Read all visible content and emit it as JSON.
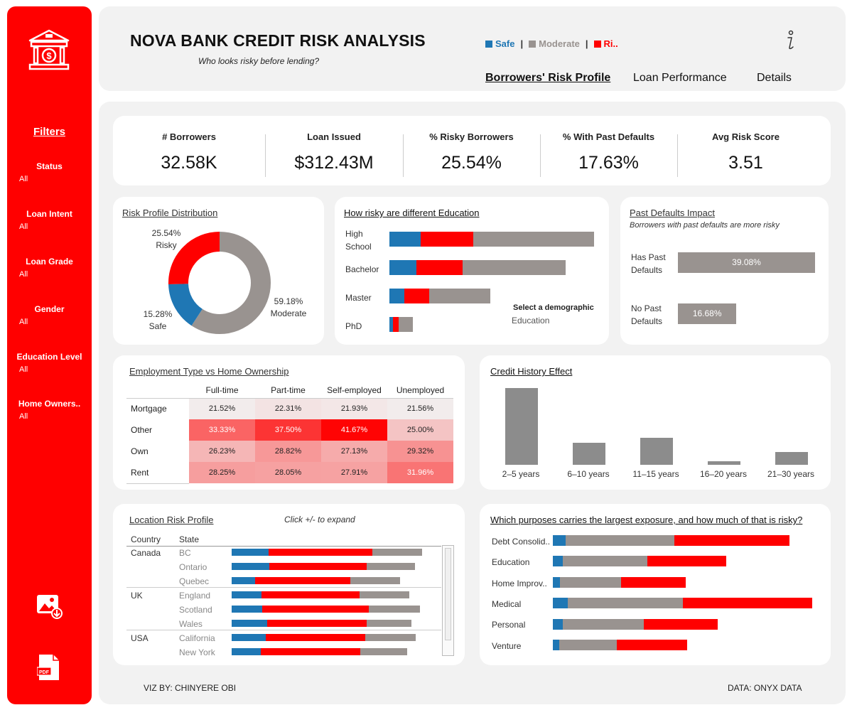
{
  "colors": {
    "safe": "#1f77b4",
    "moderate": "#999390",
    "risky": "#ff0000",
    "sidebar": "#ff0000"
  },
  "sidebar": {
    "logo_icon": "bank-icon",
    "filters_title": "Filters",
    "filters": [
      {
        "label": "Status",
        "value": "All"
      },
      {
        "label": "Loan Intent",
        "value": "All"
      },
      {
        "label": "Loan Grade",
        "value": "All"
      },
      {
        "label": "Gender",
        "value": "All"
      },
      {
        "label": "Education Level",
        "value": "All"
      },
      {
        "label": "Home Owners..",
        "value": "All"
      }
    ],
    "image_export_icon": "image-download-icon",
    "pdf_export_icon": "pdf-icon",
    "pdf_label": "PDF"
  },
  "header": {
    "title": "NOVA BANK CREDIT RISK ANALYSIS",
    "subtitle": "Who looks risky before lending?",
    "legend": {
      "safe": "Safe",
      "moderate": "Moderate",
      "risky": "Ri.."
    },
    "info_icon": "info-icon",
    "nav": [
      "Borrowers' Risk Profile",
      "Loan Performance",
      "Details"
    ]
  },
  "kpis": [
    {
      "label": "# Borrowers",
      "value": "32.58K"
    },
    {
      "label": "Loan Issued",
      "value": "$312.43M"
    },
    {
      "label": "% Risky Borrowers",
      "value": "25.54%"
    },
    {
      "label": "% With Past Defaults",
      "value": "17.63%"
    },
    {
      "label": "Avg Risk Score",
      "value": "3.51"
    }
  ],
  "risk_distribution": {
    "title": "Risk Profile Distribution",
    "risky_pct": "25.54%",
    "risky_label": "Risky",
    "safe_pct": "15.28%",
    "safe_label": "Safe",
    "moderate_pct": "59.18%",
    "moderate_label": "Moderate"
  },
  "education": {
    "title": "How risky are different Education",
    "levels": [
      "High School",
      "Bachelor",
      "Master",
      "PhD"
    ],
    "hint_title": "Select a demographic",
    "hint_value": "Education"
  },
  "past_defaults": {
    "title": "Past Defaults Impact",
    "subtitle": "Borrowers with past defaults are more risky",
    "rows": [
      {
        "label": "Has Past Defaults",
        "value": "39.08%"
      },
      {
        "label": "No Past Defaults",
        "value": "16.68%"
      }
    ]
  },
  "employment": {
    "title": "Employment Type vs Home Ownership",
    "columns": [
      "Full-time",
      "Part-time",
      "Self-employed",
      "Unemployed"
    ],
    "rows": [
      {
        "label": "Mortgage",
        "cells": [
          "21.52%",
          "22.31%",
          "21.93%",
          "21.56%"
        ]
      },
      {
        "label": "Other",
        "cells": [
          "33.33%",
          "37.50%",
          "41.67%",
          "25.00%"
        ]
      },
      {
        "label": "Own",
        "cells": [
          "26.23%",
          "28.82%",
          "27.13%",
          "29.32%"
        ]
      },
      {
        "label": "Rent",
        "cells": [
          "28.25%",
          "28.05%",
          "27.91%",
          "31.96%"
        ]
      }
    ]
  },
  "credit_history": {
    "title": "Credit History Effect",
    "categories": [
      "2–5 years",
      "6–10 years",
      "11–15 years",
      "16–20 years",
      "21–30 years"
    ]
  },
  "location": {
    "title": "Location Risk Profile",
    "hint": "Click +/- to expand",
    "col_country": "Country",
    "col_state": "State",
    "countries": [
      "Canada",
      "UK",
      "USA"
    ],
    "states": [
      "BC",
      "Ontario",
      "Quebec",
      "England",
      "Scotland",
      "Wales",
      "California",
      "New York"
    ]
  },
  "purposes": {
    "title": "Which purposes carries the largest exposure, and how much of that is risky?",
    "items": [
      "Debt Consolid..",
      "Education",
      "Home Improv..",
      "Medical",
      "Personal",
      "Venture"
    ]
  },
  "footer": {
    "left": "VIZ BY: CHINYERE OBI",
    "right": "DATA: ONYX DATA"
  },
  "chart_data": [
    {
      "type": "pie",
      "title": "Risk Profile Distribution",
      "categories": [
        "Risky",
        "Safe",
        "Moderate"
      ],
      "values": [
        25.54,
        15.28,
        59.18
      ]
    },
    {
      "type": "bar",
      "title": "How risky are different Education",
      "categories": [
        "High School",
        "Bachelor",
        "Master",
        "PhD"
      ],
      "series": [
        {
          "name": "Safe",
          "values": [
            44,
            38,
            21,
            5
          ]
        },
        {
          "name": "Risky",
          "values": [
            74,
            65,
            35,
            8
          ]
        },
        {
          "name": "Moderate",
          "values": [
            170,
            145,
            86,
            20
          ]
        }
      ]
    },
    {
      "type": "bar",
      "title": "Past Defaults Impact",
      "categories": [
        "Has Past Defaults",
        "No Past Defaults"
      ],
      "values": [
        39.08,
        16.68
      ],
      "xlim": [
        0,
        42
      ]
    },
    {
      "type": "heatmap",
      "title": "Employment Type vs Home Ownership",
      "x": [
        "Full-time",
        "Part-time",
        "Self-employed",
        "Unemployed"
      ],
      "y": [
        "Mortgage",
        "Other",
        "Own",
        "Rent"
      ],
      "values": [
        [
          21.52,
          22.31,
          21.93,
          21.56
        ],
        [
          33.33,
          37.5,
          41.67,
          25.0
        ],
        [
          26.23,
          28.82,
          27.13,
          29.32
        ],
        [
          28.25,
          28.05,
          27.91,
          31.96
        ]
      ],
      "range": [
        21,
        42
      ]
    },
    {
      "type": "bar",
      "title": "Credit History Effect",
      "categories": [
        "2–5 years",
        "6–10 years",
        "11–15 years",
        "16–20 years",
        "21–30 years"
      ],
      "values": [
        109,
        31,
        38,
        5,
        18
      ],
      "ylim": [
        0,
        115
      ]
    },
    {
      "type": "bar",
      "title": "Location Risk Profile",
      "categories": [
        "BC",
        "Ontario",
        "Quebec",
        "England",
        "Scotland",
        "Wales",
        "California",
        "New York"
      ],
      "series": [
        {
          "name": "Safe",
          "values": [
            55,
            56,
            35,
            44,
            45,
            52,
            50,
            43
          ]
        },
        {
          "name": "Risky",
          "values": [
            153,
            143,
            140,
            145,
            158,
            147,
            147,
            147
          ]
        },
        {
          "name": "Moderate",
          "values": [
            73,
            72,
            74,
            74,
            75,
            67,
            75,
            69
          ]
        }
      ]
    },
    {
      "type": "bar",
      "title": "Which purposes carries the largest exposure, and how much of that is risky?",
      "categories": [
        "Debt Consolid..",
        "Education",
        "Home Improv..",
        "Medical",
        "Personal",
        "Venture"
      ],
      "series": [
        {
          "name": "Safe",
          "values": [
            18,
            14,
            10,
            21,
            14,
            9
          ]
        },
        {
          "name": "Moderate",
          "values": [
            153,
            119,
            86,
            162,
            114,
            81
          ]
        },
        {
          "name": "Risky",
          "values": [
            162,
            111,
            91,
            182,
            104,
            99
          ]
        }
      ]
    }
  ]
}
